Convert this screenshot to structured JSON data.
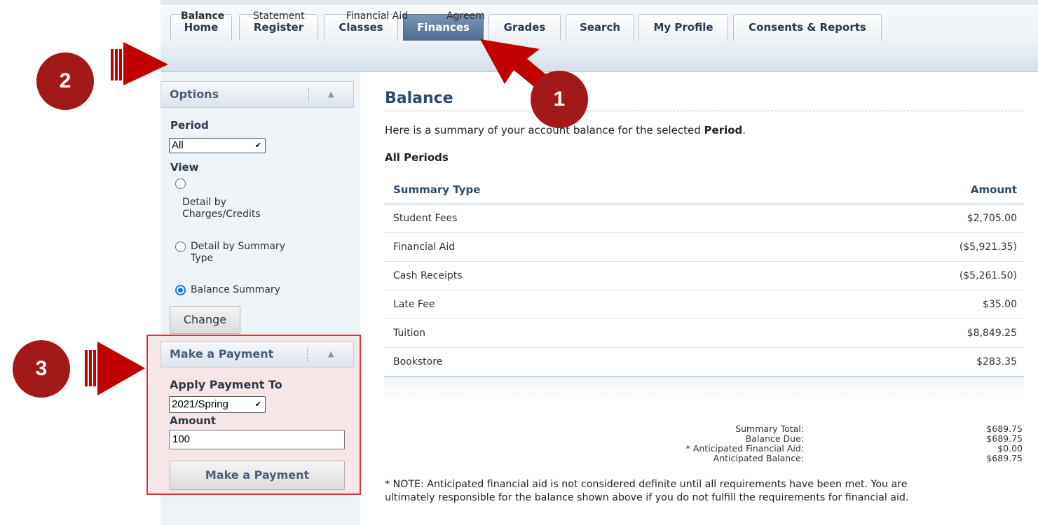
{
  "top_tabs": [
    "Home",
    "Register",
    "Classes",
    "Finances",
    "Grades",
    "Search",
    "My Profile",
    "Consents & Reports"
  ],
  "active_tab": "Finances",
  "sub_nav": [
    "Balance",
    "Statement",
    "Financial Aid",
    "Agreem"
  ],
  "sidebar": {
    "options_title": "Options",
    "period_label": "Period",
    "period_value": "All",
    "view_label": "View",
    "view_options": [
      {
        "line1": "Detail by",
        "line2": "Charges/Credits",
        "checked": false
      },
      {
        "line1": "Detail by Summary",
        "line2": "Type",
        "checked": false
      },
      {
        "line1": "Balance Summary",
        "line2": "",
        "checked": true
      }
    ],
    "change_button": "Change"
  },
  "payment": {
    "title": "Make a Payment",
    "apply_label": "Apply Payment To",
    "apply_value": "2021/Spring",
    "amount_label": "Amount",
    "amount_value": "100",
    "button": "Make a Payment"
  },
  "main": {
    "title": "Balance",
    "summary_pre": "Here is a summary of your ",
    "summary_mid": "account balance for the selected ",
    "summary_bold": "Period",
    "summary_end": ".",
    "periods_heading": "All Periods",
    "columns": [
      "Summary Type",
      "Amount"
    ],
    "rows": [
      [
        "Student Fees",
        "$2,705.00"
      ],
      [
        "Financial Aid",
        "($5,921.35)"
      ],
      [
        "Cash Receipts",
        "($5,261.50)"
      ],
      [
        "Late Fee",
        "$35.00"
      ],
      [
        "Tuition",
        "$8,849.25"
      ],
      [
        "Bookstore",
        "$283.35"
      ]
    ],
    "totals": [
      [
        "Summary Total:",
        "$689.75"
      ],
      [
        "Balance Due:",
        "$689.75"
      ],
      [
        "* Anticipated Financial Aid:",
        "$0.00"
      ],
      [
        "Anticipated Balance:",
        "$689.75"
      ]
    ],
    "note_line1": "* NOTE: Anticipated financial aid is not considered definite until all requirements have been met. You are",
    "note_line2": "ultimately responsible for the balance shown above if you do not fulfill the requirements for financial aid."
  },
  "annotations": [
    "1",
    "2",
    "3"
  ],
  "colors": {
    "annotation": "#a31818",
    "accent": "#2d4a68",
    "active_tab": "#4f6d8f",
    "highlight_box": "#d9363e"
  }
}
